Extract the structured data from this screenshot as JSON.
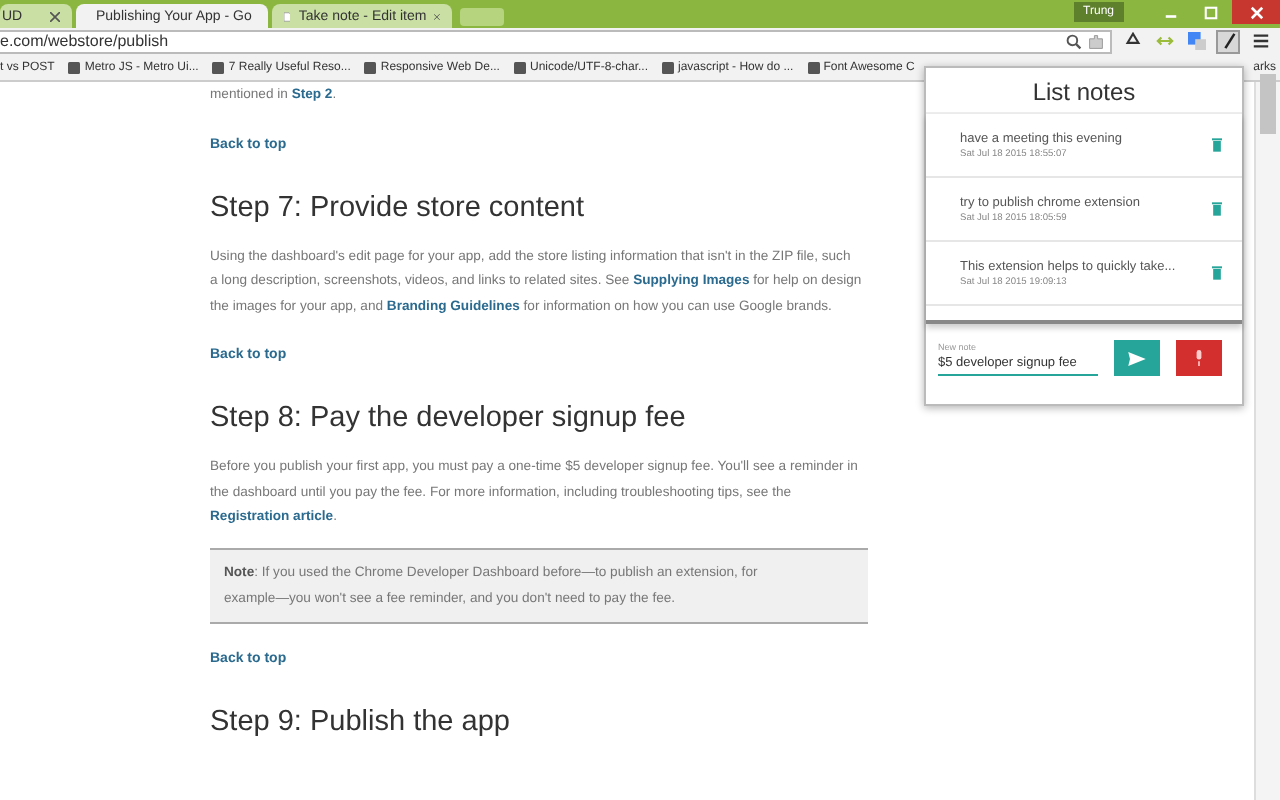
{
  "tabs": [
    {
      "title": "UD",
      "selected": false
    },
    {
      "title": "Publishing Your App - Go",
      "selected": true
    },
    {
      "title": "Take note - Edit item",
      "selected": false
    }
  ],
  "user": "Trung",
  "address": "e.com/webstore/publish",
  "bookmarks": [
    "t vs POST",
    "Metro JS - Metro Ui...",
    "7 Really Useful Reso...",
    "Responsive Web De...",
    "Unicode/UTF-8-char...",
    "javascript - How do ...",
    "Font Awesome C",
    "arks"
  ],
  "content": [
    {
      "kind": "para",
      "lines": [
        "mentioned in **Step 2**."
      ]
    },
    {
      "kind": "link",
      "text": "Back to top"
    },
    {
      "kind": "heading",
      "text": "Step 7: Provide store content"
    },
    {
      "kind": "para",
      "lines": [
        "Using the dashboard's edit page for your app, add the store listing information that isn't in the ZIP file, such",
        "a long description, screenshots, videos, and links to related sites. See **Supplying Images** for help on design",
        "the images for your app, and **Branding Guidelines** for information on how you can use Google brands."
      ]
    },
    {
      "kind": "link",
      "text": "Back to top"
    },
    {
      "kind": "heading",
      "text": "Step 8: Pay the developer signup fee"
    },
    {
      "kind": "para",
      "lines": [
        "Before you publish your first app, you must pay a one-time $5 developer signup fee. You'll see a reminder in",
        "the dashboard until you pay the fee. For more information, including troubleshooting tips, see the",
        "**Registration article**."
      ]
    },
    {
      "kind": "note",
      "lines": [
        "**Note**: If you used the Chrome Developer Dashboard before—to publish an extension, for",
        "example—you won't see a fee reminder, and you don't need to pay the fee."
      ]
    },
    {
      "kind": "link",
      "text": "Back to top"
    },
    {
      "kind": "heading",
      "text": "Step 9: Publish the app"
    }
  ],
  "popup": {
    "title": "List notes",
    "notes": [
      {
        "text": "have a meeting this evening",
        "date": "Sat Jul 18 2015 18:55:07"
      },
      {
        "text": "try to publish chrome extension",
        "date": "Sat Jul 18 2015 18:05:59"
      },
      {
        "text": "This extension helps to quickly take...",
        "date": "Sat Jul 18 2015 19:09:13"
      }
    ],
    "field": {
      "label": "New note",
      "value": "$5 developer signup fee"
    }
  }
}
